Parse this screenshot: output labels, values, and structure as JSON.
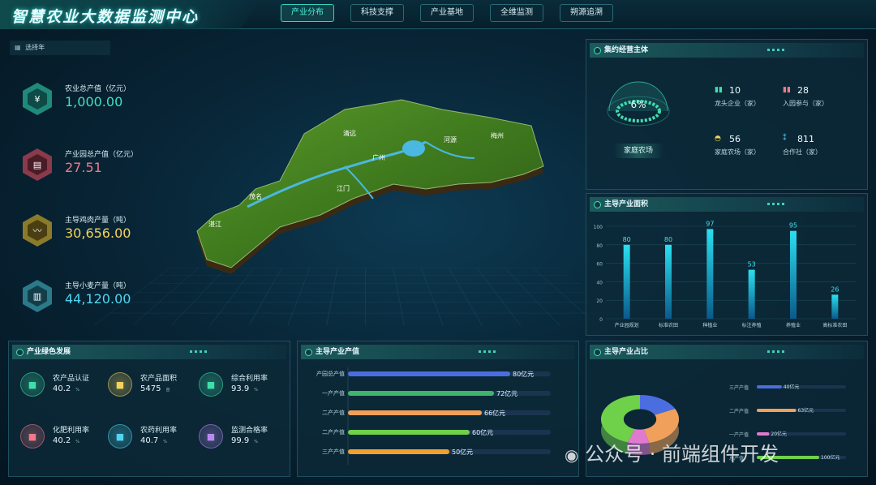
{
  "header": {
    "title": "智慧农业大数据监测中心",
    "nav": [
      "产业分布",
      "科技支撑",
      "产业基地",
      "全维监测",
      "朔源追溯"
    ],
    "active_index": 0
  },
  "year_select": {
    "label": "选择年"
  },
  "kpis": [
    {
      "label": "农业总产值（亿元）",
      "value": "1,000.00",
      "color": "#3fe0c4",
      "icon": "yen-icon"
    },
    {
      "label": "产业园总产值（亿元）",
      "value": "27.51",
      "color": "#f07a8a",
      "icon": "document-icon"
    },
    {
      "label": "主导鸡肉产量（吨）",
      "value": "30,656.00",
      "color": "#f5d35a",
      "icon": "trend-icon"
    },
    {
      "label": "主导小麦产量（吨）",
      "value": "44,120.00",
      "color": "#4fd6f0",
      "icon": "bar-chart-icon"
    }
  ],
  "map": {
    "labels": [
      "清远",
      "河源",
      "梅州",
      "广州",
      "茂名",
      "江门",
      "湛江"
    ]
  },
  "entity_panel": {
    "title": "集约经营主体",
    "gauge_value": "6%",
    "gauge_label": "家庭农场",
    "items": [
      {
        "number": "10",
        "label": "龙头企业（家）",
        "color": "#3fe0a8"
      },
      {
        "number": "28",
        "label": "入园参与（家）",
        "color": "#f07a8a"
      },
      {
        "number": "56",
        "label": "家庭农场（家）",
        "color": "#f5d35a"
      },
      {
        "number": "811",
        "label": "合作社（家）",
        "color": "#4fd6f0"
      }
    ]
  },
  "area_panel": {
    "title": "主导产业面积"
  },
  "chart_data": [
    {
      "type": "bar",
      "title": "主导产业面积",
      "categories": [
        "产业园规划",
        "标准农田",
        "种植业",
        "标注养殖",
        "养殖业",
        "高标准农田"
      ],
      "values": [
        80,
        80,
        97,
        53,
        95,
        26
      ],
      "ylim": [
        0,
        100
      ],
      "yticks": [
        0,
        20,
        40,
        60,
        80,
        100
      ],
      "grid": true
    },
    {
      "type": "bar",
      "orientation": "horizontal",
      "title": "主导产业产值",
      "categories": [
        "产园总产值",
        "一产产值",
        "二产产值",
        "二产产值",
        "三产产值"
      ],
      "values": [
        80,
        72,
        66,
        60,
        50
      ],
      "value_labels": [
        "80亿元",
        "72亿元",
        "66亿元",
        "60亿元",
        "50亿元"
      ],
      "colors": [
        "#4a6ee0",
        "#3fb56a",
        "#f0a05a",
        "#6fd04a",
        "#f0a030"
      ]
    },
    {
      "type": "pie",
      "title": "主导产业占比",
      "categories": [
        "三产产值",
        "二产产值",
        "一产产值",
        "总产值"
      ],
      "value_labels": [
        "40亿元",
        "63亿元",
        "20亿元",
        "100亿元"
      ],
      "values": [
        40,
        63,
        20,
        100
      ],
      "colors": [
        "#4a6ee0",
        "#f0a05a",
        "#e07ad0",
        "#6fd04a"
      ]
    }
  ],
  "green_panel": {
    "title": "产业绿色发展",
    "items": [
      {
        "label": "农产品认证",
        "value": "40.2",
        "unit": "%",
        "color": "#3fe0a8",
        "icon": "shield-icon"
      },
      {
        "label": "农产品面积",
        "value": "5475",
        "unit": "亩",
        "color": "#f5d35a",
        "icon": "field-icon"
      },
      {
        "label": "综合利用率",
        "value": "93.9",
        "unit": "%",
        "color": "#3fe0a8",
        "icon": "grid-icon"
      },
      {
        "label": "化肥利用率",
        "value": "40.2",
        "unit": "%",
        "color": "#f07a8a",
        "icon": "flask-icon"
      },
      {
        "label": "农药利用率",
        "value": "40.7",
        "unit": "%",
        "color": "#4fd6f0",
        "icon": "bottle-icon"
      },
      {
        "label": "监测合格率",
        "value": "99.9",
        "unit": "%",
        "color": "#b88af0",
        "icon": "cube-icon"
      }
    ]
  },
  "value_panel": {
    "title": "主导产业产值"
  },
  "share_panel": {
    "title": "主导产业占比"
  },
  "watermark": "公众号 · 前端组件开发"
}
